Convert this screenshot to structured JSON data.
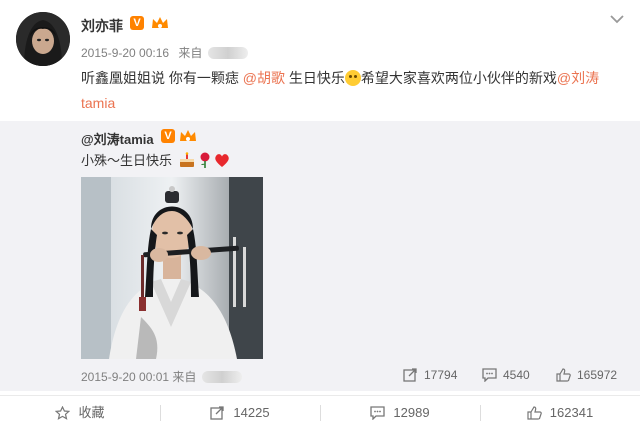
{
  "post": {
    "author": "刘亦菲",
    "timestamp": "2015-9-20 00:16",
    "source_prefix": "来自",
    "text_parts": [
      {
        "t": "听鑫凰姐姐说 你有一颗痣 ",
        "mention": false
      },
      {
        "t": "@胡歌",
        "mention": true
      },
      {
        "t": " 生日快乐",
        "mention": false
      },
      {
        "t": "希望大家喜欢两位小伙伴的新戏",
        "mention": false
      },
      {
        "t": "@刘涛tamia",
        "mention": true
      }
    ]
  },
  "repost": {
    "author": "@刘涛tamia",
    "text": "小殊～生日快乐",
    "timestamp": "2015-9-20 00:01",
    "source_prefix": "来自",
    "shares": "17794",
    "comments": "4540",
    "likes": "165972"
  },
  "actions": {
    "favorite": "收藏",
    "share": "14225",
    "comment": "12989",
    "like": "162341"
  },
  "colors": {
    "mention": "#eb7350",
    "verified": "#ff8200",
    "repost_bg": "#f2f2f5"
  },
  "icons": [
    "dropdown-chevron-icon",
    "verified-icon",
    "vip-crown-icon",
    "star-icon",
    "share-icon",
    "comment-icon",
    "like-icon",
    "cake-icon",
    "rose-icon",
    "heart-icon",
    "emoji-icon"
  ]
}
